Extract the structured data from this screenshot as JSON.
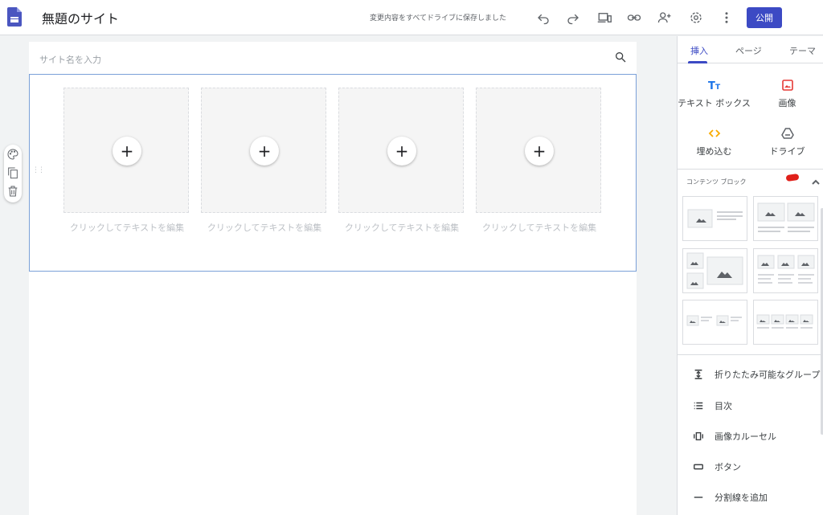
{
  "app": {
    "title": "無題のサイト",
    "save_status": "変更内容をすべてドライブに保存しました",
    "publish_label": "公開",
    "toolbar_icons": [
      "undo-icon",
      "redo-icon",
      "preview-icon",
      "link-icon",
      "share-icon",
      "settings-icon",
      "more-icon"
    ]
  },
  "canvas": {
    "site_name_placeholder": "サイト名を入力",
    "cards": [
      {
        "caption": "クリックしてテキストを編集"
      },
      {
        "caption": "クリックしてテキストを編集"
      },
      {
        "caption": "クリックしてテキストを編集"
      },
      {
        "caption": "クリックしてテキストを編集"
      }
    ],
    "plus_glyph": "+"
  },
  "panel": {
    "tabs": [
      {
        "label": "挿入",
        "active": true
      },
      {
        "label": "ページ",
        "active": false
      },
      {
        "label": "テーマ",
        "active": false
      }
    ],
    "insert_items": [
      {
        "label": "テキスト ボックス",
        "icon": "text-box-icon"
      },
      {
        "label": "画像",
        "icon": "image-icon"
      },
      {
        "label": "埋め込む",
        "icon": "embed-icon"
      },
      {
        "label": "ドライブ",
        "icon": "drive-icon"
      }
    ],
    "content_blocks_title": "コンテンツ ブロック",
    "layout_blocks": 6,
    "list_items": [
      {
        "label": "折りたたみ可能なグループ",
        "icon": "collapsible-group-icon"
      },
      {
        "label": "目次",
        "icon": "table-of-contents-icon"
      },
      {
        "label": "画像カルーセル",
        "icon": "image-carousel-icon"
      },
      {
        "label": "ボタン",
        "icon": "button-icon"
      },
      {
        "label": "分割線を追加",
        "icon": "divider-icon"
      }
    ]
  },
  "colors": {
    "accent": "#3c4ac4",
    "selection_border": "#7aa0d8",
    "image_icon": "#e53935",
    "embed_icon": "#f9ab00",
    "mark": "#e0201a"
  }
}
